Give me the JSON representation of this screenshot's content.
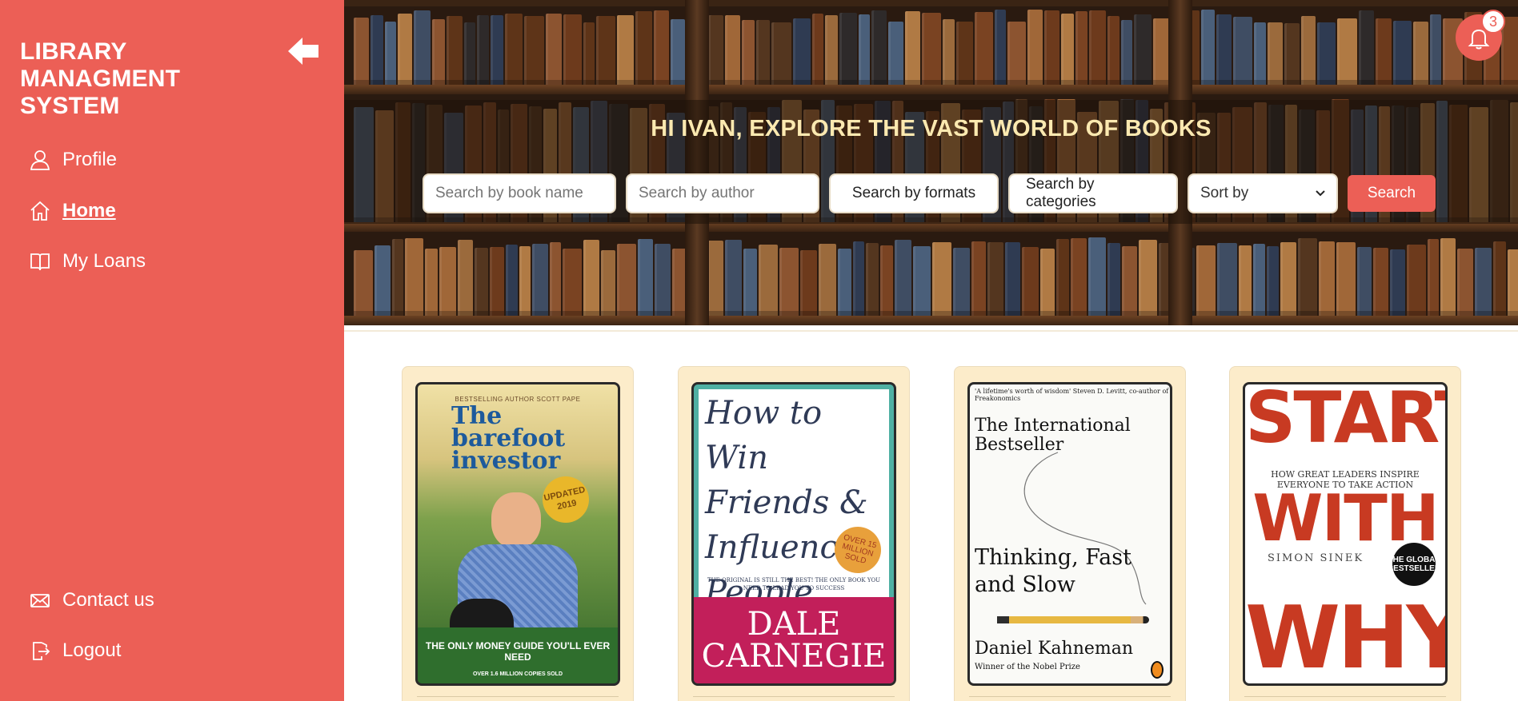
{
  "app": {
    "brand": "LIBRARY MANAGMENT SYSTEM",
    "accent_color": "#ec5f56",
    "title_color": "#fbe9b0"
  },
  "sidebar": {
    "collapse_icon": "arrow-left-icon",
    "nav": [
      {
        "label": "Profile",
        "icon": "user-icon",
        "active": false
      },
      {
        "label": "Home",
        "icon": "home-icon",
        "active": true
      },
      {
        "label": "My Loans",
        "icon": "book-open-icon",
        "active": false
      }
    ],
    "footer": [
      {
        "label": "Contact us",
        "icon": "mail-icon"
      },
      {
        "label": "Logout",
        "icon": "logout-icon"
      }
    ]
  },
  "hero": {
    "title": "HI IVAN, EXPLORE THE VAST WORLD OF BOOKS",
    "book_name_placeholder": "Search by book name",
    "author_placeholder": "Search by author",
    "formats_label": "Search by formats",
    "categories_label": "Search by categories",
    "sort_label": "Sort by",
    "search_button": "Search"
  },
  "notifications": {
    "icon": "bell-icon",
    "count": "3"
  },
  "books": [
    {
      "title": "The barefoot investor",
      "top_line": "BESTSELLING AUTHOR SCOTT PAPE",
      "badge": "UPDATED 2019",
      "tagline": "THE ONLY MONEY GUIDE YOU'LL EVER NEED",
      "footnote": "OVER 1.6 MILLION COPIES SOLD"
    },
    {
      "title": "How to Win Friends & Influence People",
      "sticker": "OVER 15 MILLION SOLD",
      "subtitle": "THE ORIGINAL IS STILL THE BEST! THE ONLY BOOK YOU NEED TO LEAD YOU TO SUCCESS",
      "author": "DALE CARNEGIE"
    },
    {
      "quote": "'A lifetime's worth of wisdom' Steven D. Levitt, co-author of Freakonomics",
      "kicker": "The International Bestseller",
      "title": "Thinking, Fast and Slow",
      "author": "Daniel Kahneman",
      "award": "Winner of the Nobel Prize"
    },
    {
      "title_top": "START",
      "subtitle": "HOW GREAT LEADERS INSPIRE EVERYONE TO TAKE ACTION",
      "title_mid": "WITH",
      "author": "SIMON SINEK",
      "badge": "THE GLOBAL BESTSELLER",
      "title_bottom": "WHY"
    }
  ]
}
